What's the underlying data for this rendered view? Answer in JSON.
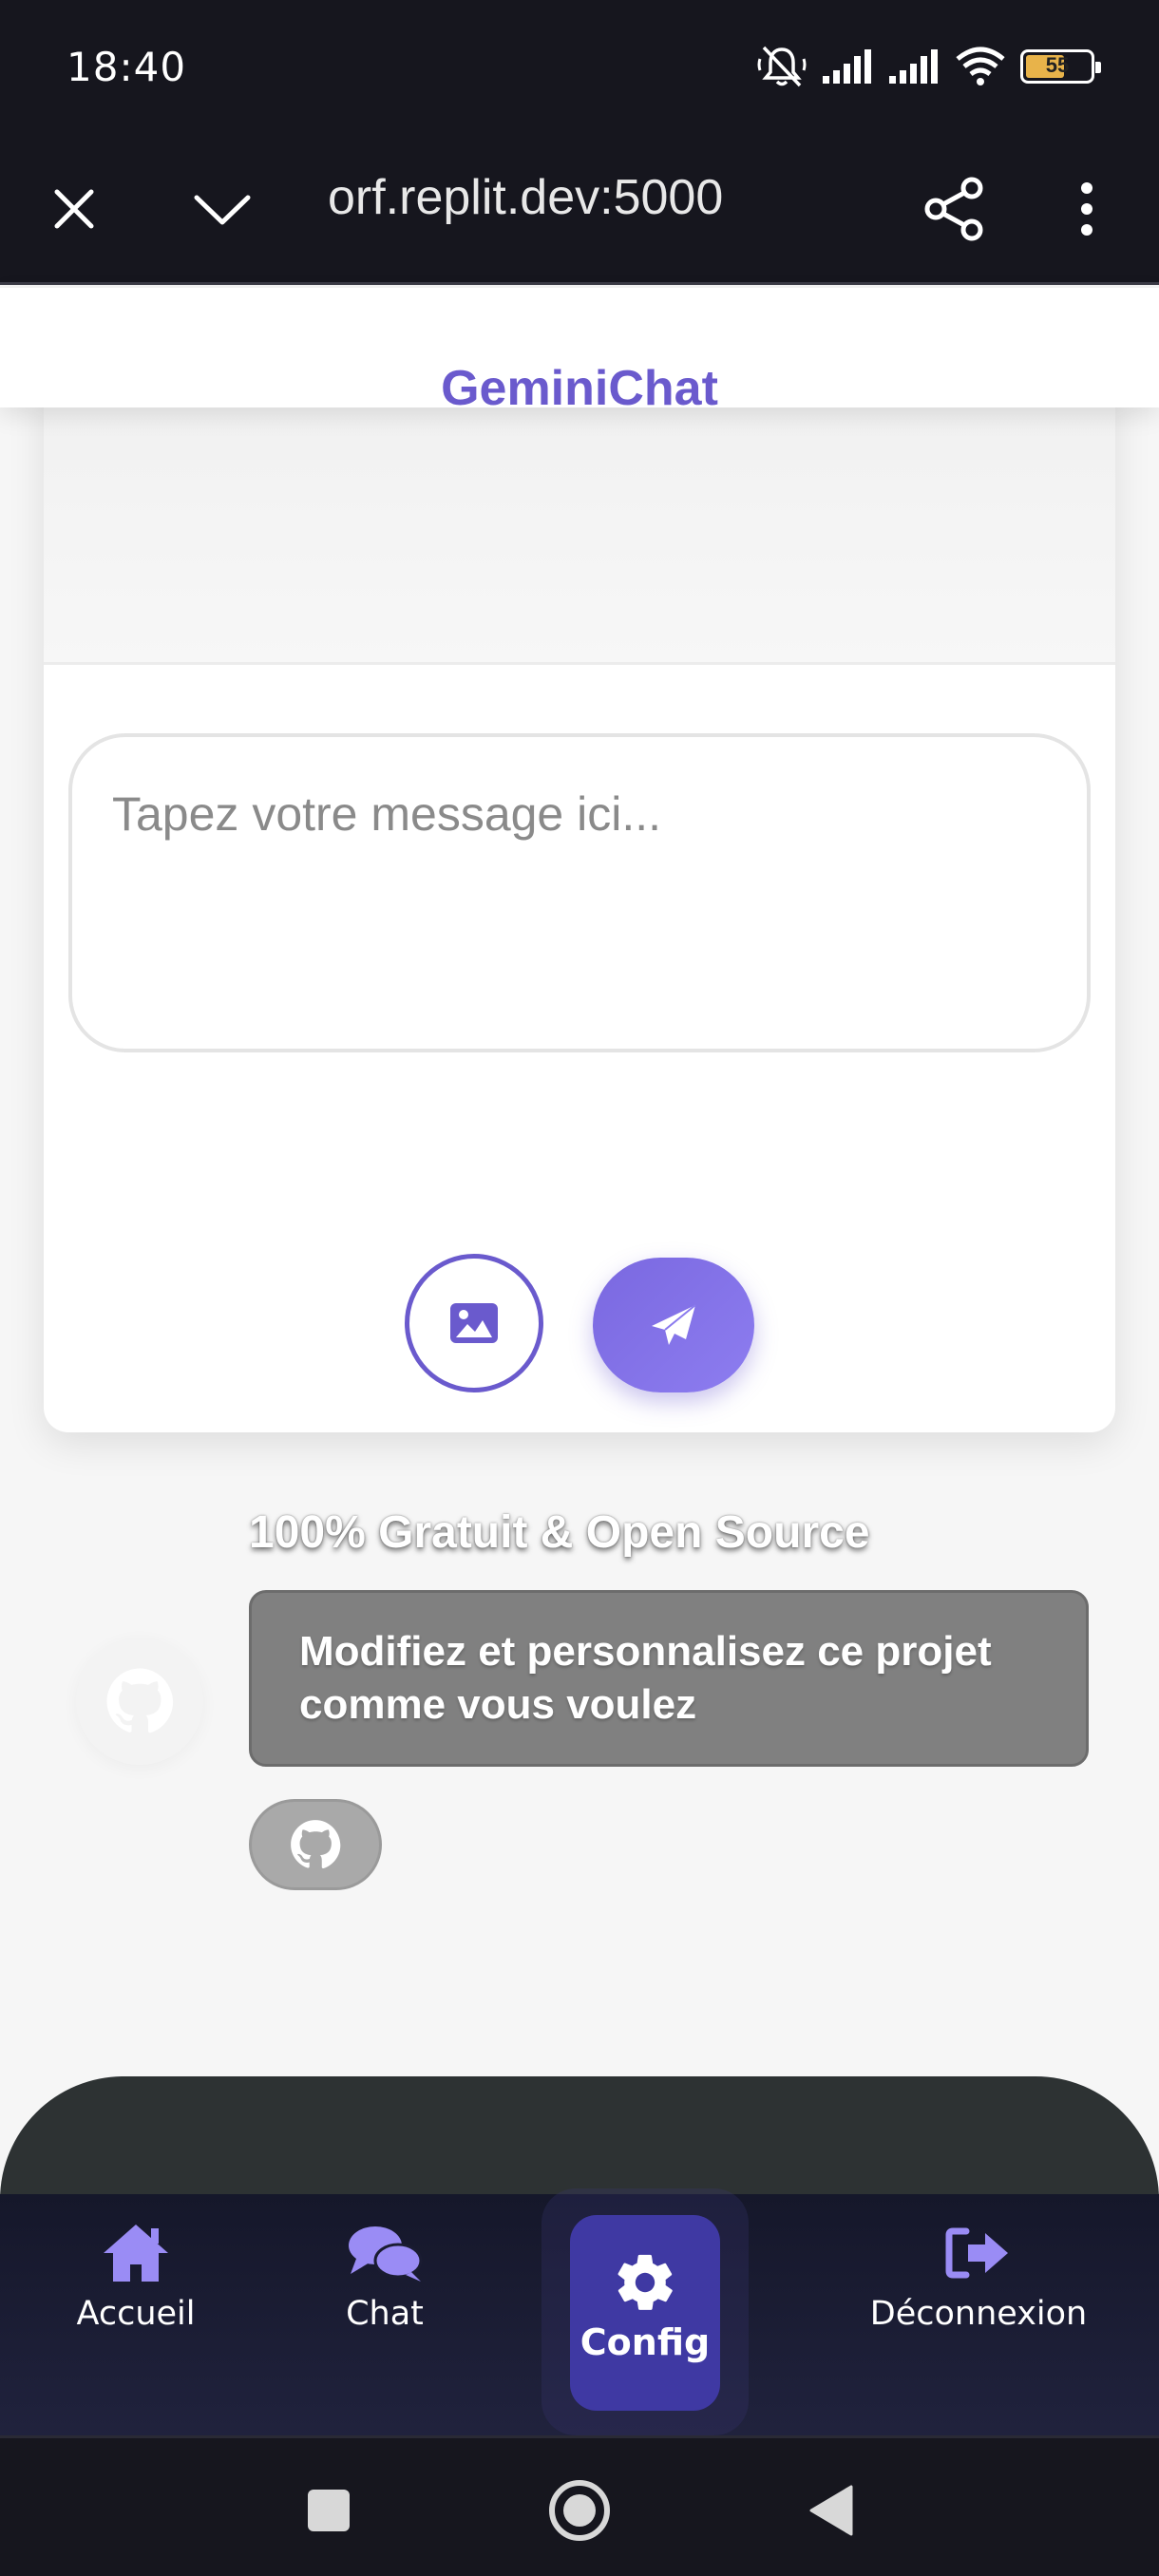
{
  "status_bar": {
    "time": "18:40",
    "battery": "55",
    "battery_level": 0.55,
    "icons": [
      "mute-icon",
      "signal-icon",
      "signal-icon",
      "wifi-icon",
      "battery-icon"
    ]
  },
  "browser": {
    "url": "orf.replit.dev:5000",
    "close_icon": "close-icon",
    "dropdown_icon": "chevron-down-icon",
    "share_icon": "share-icon",
    "menu_icon": "more-vert-icon"
  },
  "header": {
    "title": "GeminiChat"
  },
  "chat": {
    "input_placeholder": "Tapez votre message ici...",
    "input_value": "",
    "image_button_icon": "image-icon",
    "send_button_icon": "paper-plane-icon"
  },
  "promo": {
    "title": "100% Gratuit & Open Source",
    "description": "Modifiez et personnalisez ce projet comme vous voulez",
    "github_icon": "github-icon"
  },
  "nav": {
    "items": [
      {
        "label": "Accueil",
        "icon": "home-icon"
      },
      {
        "label": "Chat",
        "icon": "comments-icon"
      },
      {
        "label": "Config",
        "icon": "gear-icon",
        "active": true
      },
      {
        "label": "Déconnexion",
        "icon": "logout-icon"
      }
    ]
  },
  "colors": {
    "accent": "#6a5acd",
    "nav_active": "#3f39a3",
    "nav_icon": "#9a8cf5"
  }
}
